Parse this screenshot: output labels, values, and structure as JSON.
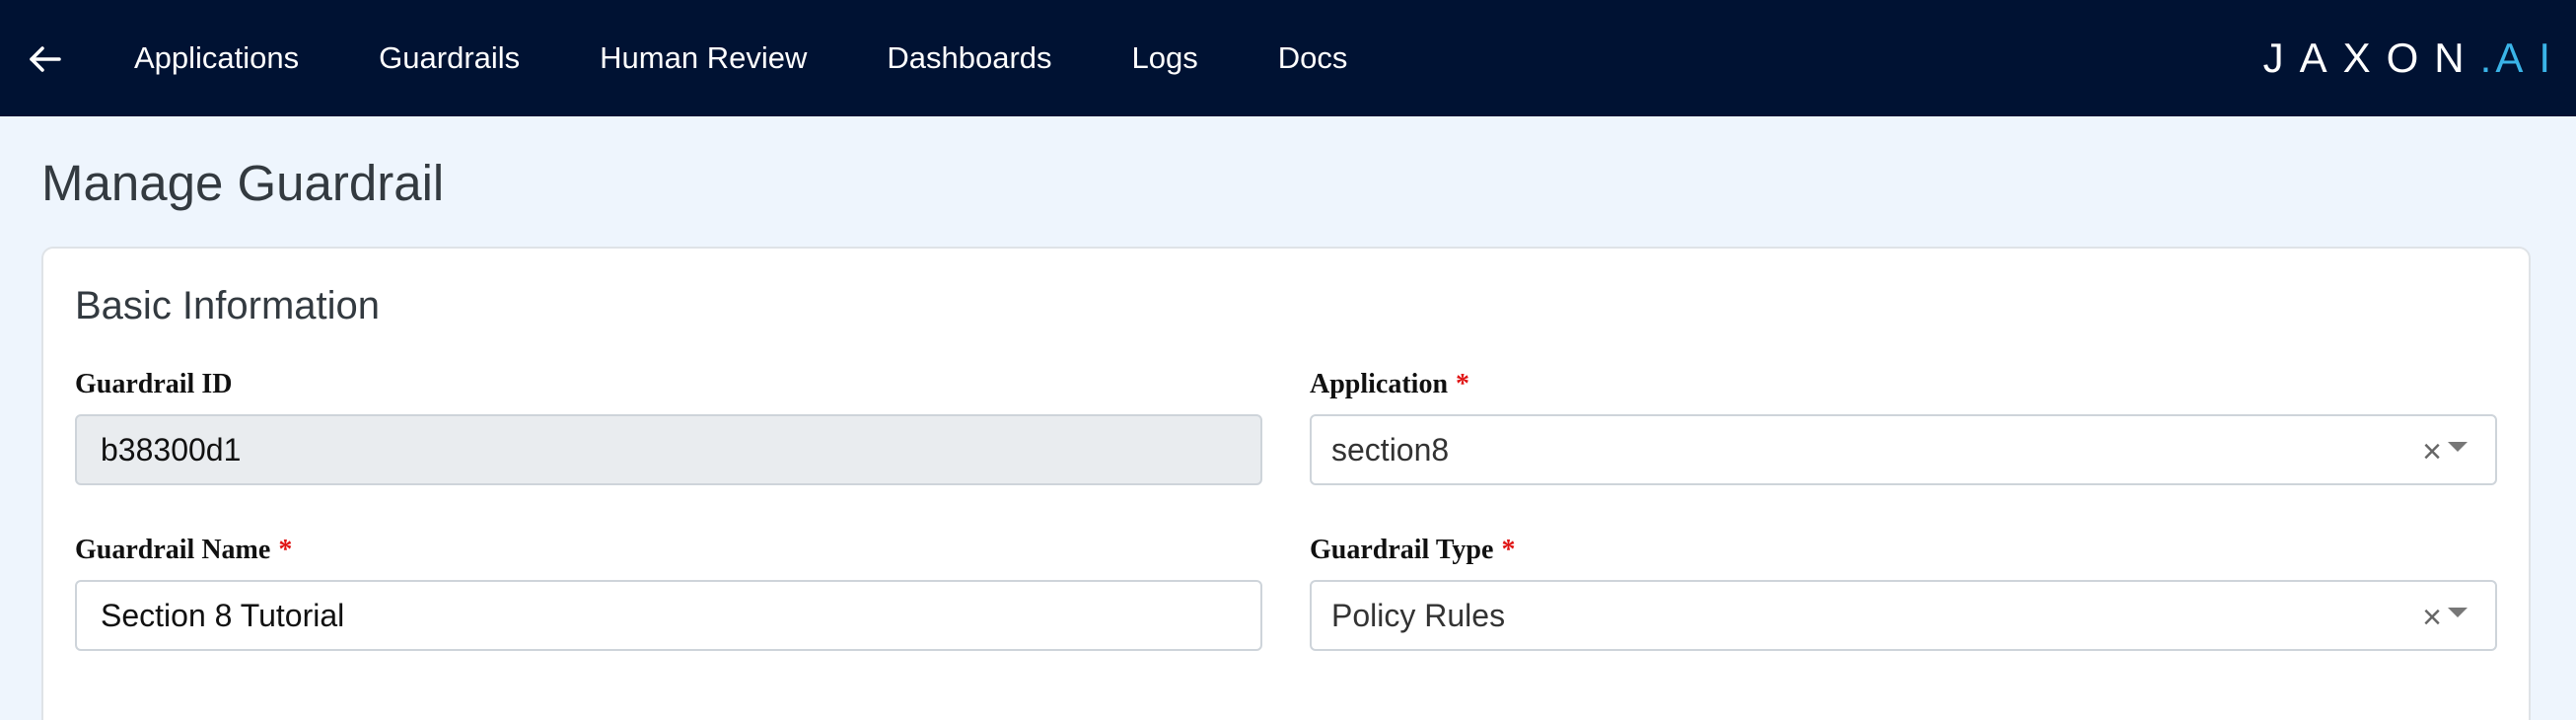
{
  "navbar": {
    "back_icon": "arrow-left-icon",
    "items": [
      {
        "label": "Applications"
      },
      {
        "label": "Guardrails"
      },
      {
        "label": "Human Review"
      },
      {
        "label": "Dashboards"
      },
      {
        "label": "Logs"
      },
      {
        "label": "Docs"
      }
    ],
    "logo": {
      "main": "JAXON",
      "dot": ".",
      "suffix": "AI"
    },
    "colors": {
      "background": "#001233",
      "accent": "#3ab4e8"
    }
  },
  "page": {
    "title": "Manage Guardrail"
  },
  "basic_info": {
    "title": "Basic Information",
    "guardrail_id": {
      "label": "Guardrail ID",
      "value": "b38300d1"
    },
    "application": {
      "label": "Application",
      "required_mark": "*",
      "value": "section8"
    },
    "guardrail_name": {
      "label": "Guardrail Name",
      "required_mark": "*",
      "value": "Section 8 Tutorial"
    },
    "guardrail_type": {
      "label": "Guardrail Type",
      "required_mark": "*",
      "value": "Policy Rules"
    },
    "clear_glyph": "×"
  }
}
